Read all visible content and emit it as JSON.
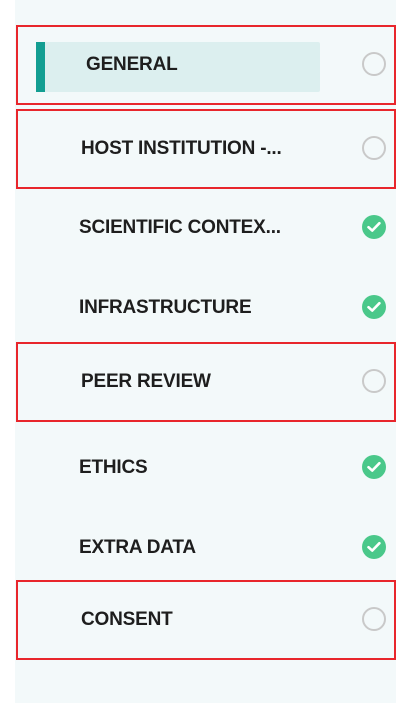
{
  "colors": {
    "accent": "#139e92",
    "complete": "#4ac88a",
    "incomplete_ring": "#c9c9c9",
    "highlight_box": "#e8262c"
  },
  "steps": [
    {
      "label": "GENERAL",
      "status": "incomplete",
      "icon": "empty-circle-icon",
      "active": true
    },
    {
      "label": "HOST INSTITUTION -...",
      "status": "incomplete",
      "icon": "empty-circle-icon"
    },
    {
      "label": "SCIENTIFIC CONTEX...",
      "status": "complete",
      "icon": "check-circle-icon"
    },
    {
      "label": "INFRASTRUCTURE",
      "status": "complete",
      "icon": "check-circle-icon"
    },
    {
      "label": "PEER REVIEW",
      "status": "incomplete",
      "icon": "empty-circle-icon"
    },
    {
      "label": "ETHICS",
      "status": "complete",
      "icon": "check-circle-icon"
    },
    {
      "label": "EXTRA DATA",
      "status": "complete",
      "icon": "check-circle-icon"
    },
    {
      "label": "CONSENT",
      "status": "incomplete",
      "icon": "empty-circle-icon"
    }
  ]
}
